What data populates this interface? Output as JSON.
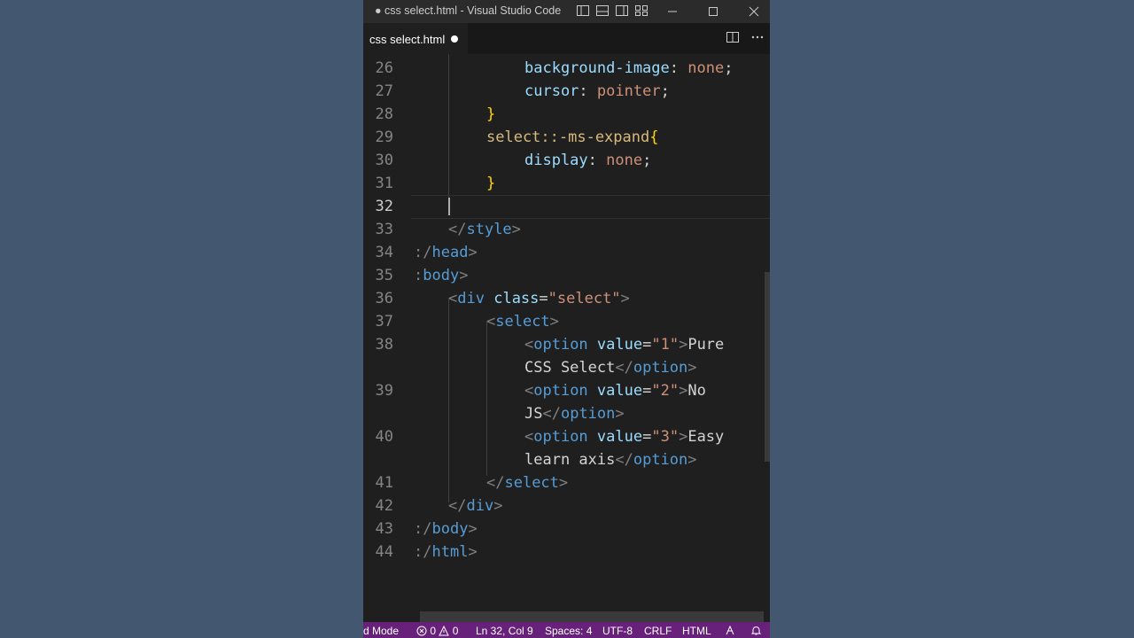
{
  "window": {
    "title": "● css select.html - Visual Studio Code",
    "controls": {
      "minimize": "—",
      "maximize": "☐",
      "close": "✕"
    }
  },
  "tab": {
    "label": "css select.html",
    "modified": true
  },
  "tab_actions": {
    "split_icon": "split-editor-icon",
    "more_icon": "more-actions-icon"
  },
  "editor": {
    "line_numbers": [
      "26",
      "27",
      "28",
      "29",
      "30",
      "31",
      "32",
      "33",
      "34",
      "35",
      "36",
      "37",
      "38",
      "39",
      "40",
      "41",
      "42",
      "43",
      "44"
    ],
    "lines": {
      "l26_prop": "background-image",
      "l26_colon": ": ",
      "l26_val": "none",
      "l26_semi": ";",
      "l27_prop": "cursor",
      "l27_colon": ": ",
      "l27_val": "pointer",
      "l27_semi": ";",
      "l28_brace": "}",
      "l29_sel": "select::-ms-expand",
      "l29_brace": "{",
      "l30_prop": "display",
      "l30_colon": ": ",
      "l30_val": "none",
      "l30_semi": ";",
      "l31_brace": "}",
      "l33_open": "</",
      "l33_tag": "style",
      "l33_close": ">",
      "l34_open": ":/",
      "l34_tag": "head",
      "l34_close": ">",
      "l35_open": ":",
      "l35_tag": "body",
      "l35_close": ">",
      "l36_open": "<",
      "l36_tag": "div",
      "l36_attr": "class",
      "l36_eq": "=",
      "l36_str": "\"select\"",
      "l36_close": ">",
      "l37_open": "<",
      "l37_tag": "select",
      "l37_close": ">",
      "l38_open": "<",
      "l38_tag": "option",
      "l38_attr": "value",
      "l38_eq": "=",
      "l38_str": "\"1\"",
      "l38_close": ">",
      "l38_text": "Pure",
      "l38b_text": "CSS Select",
      "l38b_open": "</",
      "l38b_tag": "option",
      "l38b_close": ">",
      "l39_open": "<",
      "l39_tag": "option",
      "l39_attr": "value",
      "l39_eq": "=",
      "l39_str": "\"2\"",
      "l39_close": ">",
      "l39_text": "No",
      "l39b_text": "JS",
      "l39b_open": "</",
      "l39b_tag": "option",
      "l39b_close": ">",
      "l40_open": "<",
      "l40_tag": "option",
      "l40_attr": "value",
      "l40_eq": "=",
      "l40_str": "\"3\"",
      "l40_close": ">",
      "l40_text": "Easy",
      "l40b_text": "learn axis",
      "l40b_open": "</",
      "l40b_tag": "option",
      "l40b_close": ">",
      "l41_open": "</",
      "l41_tag": "select",
      "l41_close": ">",
      "l42_open": "</",
      "l42_tag": "div",
      "l42_close": ">",
      "l43_open": ":/",
      "l43_tag": "body",
      "l43_close": ">",
      "l44_open": ":/",
      "l44_tag": "html",
      "l44_close": ">"
    }
  },
  "statusbar": {
    "mode": "d Mode",
    "errors": "0",
    "warnings": "0",
    "position": "Ln 32, Col 9",
    "spaces": "Spaces: 4",
    "encoding": "UTF-8",
    "eol": "CRLF",
    "language": "HTML"
  },
  "colors": {
    "background": "#435870",
    "editor_bg": "#1f1f1f",
    "statusbar": "#68217a"
  }
}
